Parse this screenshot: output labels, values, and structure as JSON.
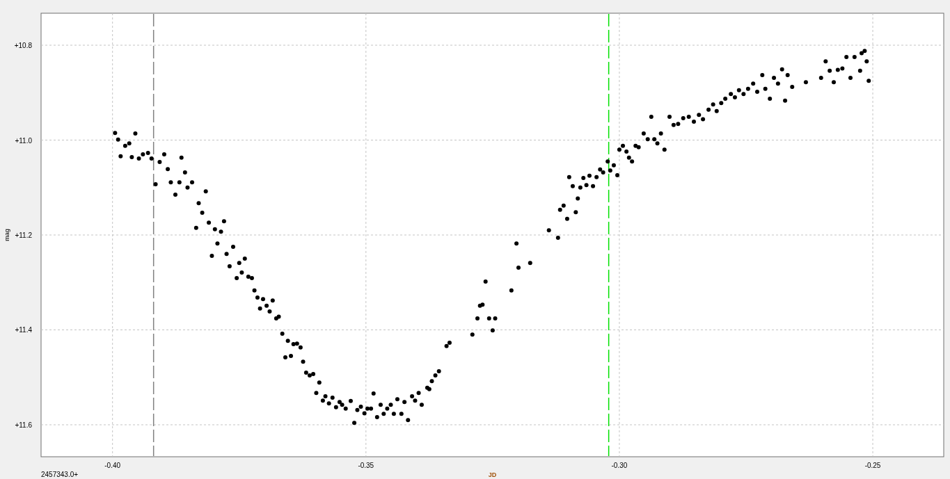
{
  "plot": {
    "axis_offset": "2457343.0+",
    "chart_data": {
      "type": "scatter",
      "xlabel": "JD",
      "ylabel": "mag",
      "xlim": [
        -0.4141,
        -0.236
      ],
      "ylim": [
        11.6674,
        10.7326
      ],
      "xticks": [
        {
          "value": -0.4,
          "label": "-0.40"
        },
        {
          "value": -0.35,
          "label": "-0.35"
        },
        {
          "value": -0.3,
          "label": "-0.30"
        },
        {
          "value": -0.25,
          "label": "-0.25"
        }
      ],
      "yticks": [
        {
          "value": 10.8,
          "label": "+10.8"
        },
        {
          "value": 11.0,
          "label": "+11.0"
        },
        {
          "value": 11.2,
          "label": "+11.2"
        },
        {
          "value": 11.4,
          "label": "+11.4"
        },
        {
          "value": 11.6,
          "label": "+11.6"
        }
      ],
      "grid": true,
      "ref_lines": [
        {
          "axis": "x",
          "value": -0.3919,
          "color": "#808080"
        },
        {
          "axis": "x",
          "value": -0.3021,
          "color": "#00e000"
        }
      ],
      "x": [
        -0.3995,
        -0.3989,
        -0.3984,
        -0.3975,
        -0.3967,
        -0.3962,
        -0.3955,
        -0.3948,
        -0.394,
        -0.393,
        -0.3923,
        -0.3915,
        -0.3907,
        -0.3898,
        -0.3891,
        -0.3885,
        -0.3876,
        -0.3868,
        -0.3864,
        -0.3857,
        -0.3852,
        -0.3843,
        -0.3835,
        -0.383,
        -0.3823,
        -0.3816,
        -0.381,
        -0.3804,
        -0.3798,
        -0.3793,
        -0.3786,
        -0.378,
        -0.3775,
        -0.3769,
        -0.3762,
        -0.3755,
        -0.375,
        -0.3745,
        -0.3739,
        -0.3732,
        -0.3725,
        -0.372,
        -0.3714,
        -0.3709,
        -0.3703,
        -0.3696,
        -0.369,
        -0.3684,
        -0.3677,
        -0.3672,
        -0.3665,
        -0.3659,
        -0.3654,
        -0.3648,
        -0.3643,
        -0.3636,
        -0.3629,
        -0.3624,
        -0.3618,
        -0.3611,
        -0.3604,
        -0.3598,
        -0.3592,
        -0.3585,
        -0.358,
        -0.3573,
        -0.3566,
        -0.3559,
        -0.3552,
        -0.3547,
        -0.354,
        -0.353,
        -0.3523,
        -0.3517,
        -0.351,
        -0.3503,
        -0.3497,
        -0.349,
        -0.3485,
        -0.3478,
        -0.3471,
        -0.3465,
        -0.3458,
        -0.3451,
        -0.3445,
        -0.3438,
        -0.343,
        -0.3424,
        -0.3417,
        -0.3409,
        -0.3403,
        -0.3396,
        -0.339,
        -0.3379,
        -0.3375,
        -0.337,
        -0.3363,
        -0.3356,
        -0.3341,
        -0.3335,
        -0.329,
        -0.328,
        -0.3275,
        -0.327,
        -0.3264,
        -0.3257,
        -0.325,
        -0.3245,
        -0.3213,
        -0.3203,
        -0.3199,
        -0.3176,
        -0.3139,
        -0.3121,
        -0.3117,
        -0.311,
        -0.3103,
        -0.3099,
        -0.3092,
        -0.3086,
        -0.3082,
        -0.3077,
        -0.3071,
        -0.3065,
        -0.3059,
        -0.3052,
        -0.3045,
        -0.3038,
        -0.3032,
        -0.3023,
        -0.3018,
        -0.3011,
        -0.3004,
        -0.3,
        -0.2993,
        -0.2986,
        -0.2981,
        -0.2975,
        -0.2968,
        -0.2962,
        -0.2952,
        -0.2944,
        -0.2937,
        -0.2931,
        -0.2925,
        -0.2918,
        -0.2911,
        -0.2901,
        -0.2893,
        -0.2884,
        -0.2874,
        -0.2863,
        -0.2853,
        -0.2843,
        -0.2835,
        -0.2824,
        -0.2815,
        -0.2808,
        -0.2799,
        -0.2791,
        -0.278,
        -0.2772,
        -0.2764,
        -0.2755,
        -0.2746,
        -0.2736,
        -0.2728,
        -0.2718,
        -0.2712,
        -0.2703,
        -0.2695,
        -0.2687,
        -0.2679,
        -0.2673,
        -0.2668,
        -0.2659,
        -0.2632,
        -0.2602,
        -0.2593,
        -0.2585,
        -0.2577,
        -0.2569,
        -0.256,
        -0.2552,
        -0.2544,
        -0.2536,
        -0.2525,
        -0.2522,
        -0.2516,
        -0.2512,
        -0.2508
      ],
      "series": [
        {
          "color": "#000000",
          "values": [
            10.985,
            10.999,
            11.034,
            11.012,
            11.007,
            11.036,
            10.986,
            11.039,
            11.03,
            11.027,
            11.039,
            11.093,
            11.046,
            11.03,
            11.061,
            11.089,
            11.115,
            11.089,
            11.037,
            11.068,
            11.1,
            11.089,
            11.185,
            11.133,
            11.153,
            11.108,
            11.174,
            11.244,
            11.188,
            11.218,
            11.193,
            11.171,
            11.24,
            11.266,
            11.225,
            11.291,
            11.259,
            11.279,
            11.25,
            11.288,
            11.291,
            11.317,
            11.332,
            11.355,
            11.335,
            11.349,
            11.361,
            11.338,
            11.376,
            11.372,
            11.408,
            11.458,
            11.423,
            11.455,
            11.43,
            11.429,
            11.437,
            11.467,
            11.49,
            11.496,
            11.493,
            11.533,
            11.511,
            11.549,
            11.54,
            11.555,
            11.543,
            11.563,
            11.552,
            11.558,
            11.566,
            11.55,
            11.596,
            11.569,
            11.562,
            11.576,
            11.566,
            11.566,
            11.534,
            11.584,
            11.558,
            11.577,
            11.566,
            11.558,
            11.577,
            11.546,
            11.577,
            11.552,
            11.59,
            11.54,
            11.549,
            11.533,
            11.558,
            11.522,
            11.525,
            11.508,
            11.496,
            11.487,
            11.434,
            11.427,
            11.41,
            11.376,
            11.349,
            11.347,
            11.298,
            11.376,
            11.401,
            11.376,
            11.317,
            11.218,
            11.269,
            11.259,
            11.19,
            11.206,
            11.147,
            11.138,
            11.166,
            11.078,
            11.097,
            11.152,
            11.123,
            11.1,
            11.08,
            11.095,
            11.075,
            11.097,
            11.078,
            11.062,
            11.068,
            11.045,
            11.064,
            11.053,
            11.074,
            11.02,
            11.012,
            11.024,
            11.037,
            11.045,
            11.012,
            11.015,
            10.986,
            10.998,
            10.951,
            10.998,
            11.007,
            10.986,
            11.02,
            10.951,
            10.968,
            10.966,
            10.954,
            10.951,
            10.961,
            10.947,
            10.956,
            10.936,
            10.925,
            10.939,
            10.922,
            10.913,
            10.903,
            10.91,
            10.895,
            10.903,
            10.892,
            10.881,
            10.898,
            10.863,
            10.892,
            10.913,
            10.869,
            10.881,
            10.851,
            10.917,
            10.863,
            10.888,
            10.878,
            10.869,
            10.834,
            10.854,
            10.878,
            10.852,
            10.849,
            10.825,
            10.869,
            10.825,
            10.854,
            10.817,
            10.812,
            10.834,
            10.875
          ]
        }
      ]
    }
  }
}
